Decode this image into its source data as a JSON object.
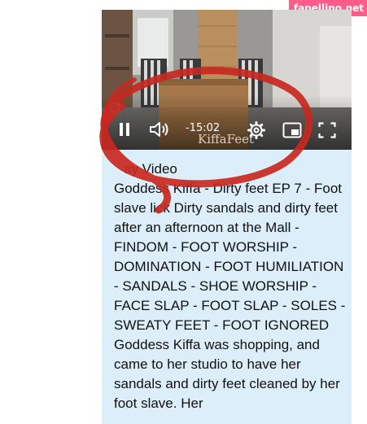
{
  "watermark": {
    "text": "fapellino.net"
  },
  "player": {
    "time_remaining": "-15:02",
    "overlay_watermark": "KiffaFeet",
    "play_label": "ay Video",
    "icons": [
      "pause-icon",
      "volume-icon",
      "settings-icon",
      "picture-in-picture-icon",
      "fullscreen-icon"
    ]
  },
  "content": {
    "title": "Goddess Kiffa - Dirty feet EP 7 - Foot slave lick Dirty sandals and dirty feet after an afternoon at the Mall - FINDOM - FOOT WORSHIP - DOMINATION - FOOT HUMILIATION - SANDALS - SHOE WORSHIP - FACE SLAP - FOOT SLAP - SOLES - SWEATY FEET - FOOT IGNORED",
    "description": "Goddess Kiffa was shopping, and came to her studio to have her sandals and dirty feet cleaned by her foot slave. Her"
  },
  "colors": {
    "card_bg": "#dceefa",
    "scribble": "#c8281e",
    "watermark_bg": "#ff5c8a"
  }
}
